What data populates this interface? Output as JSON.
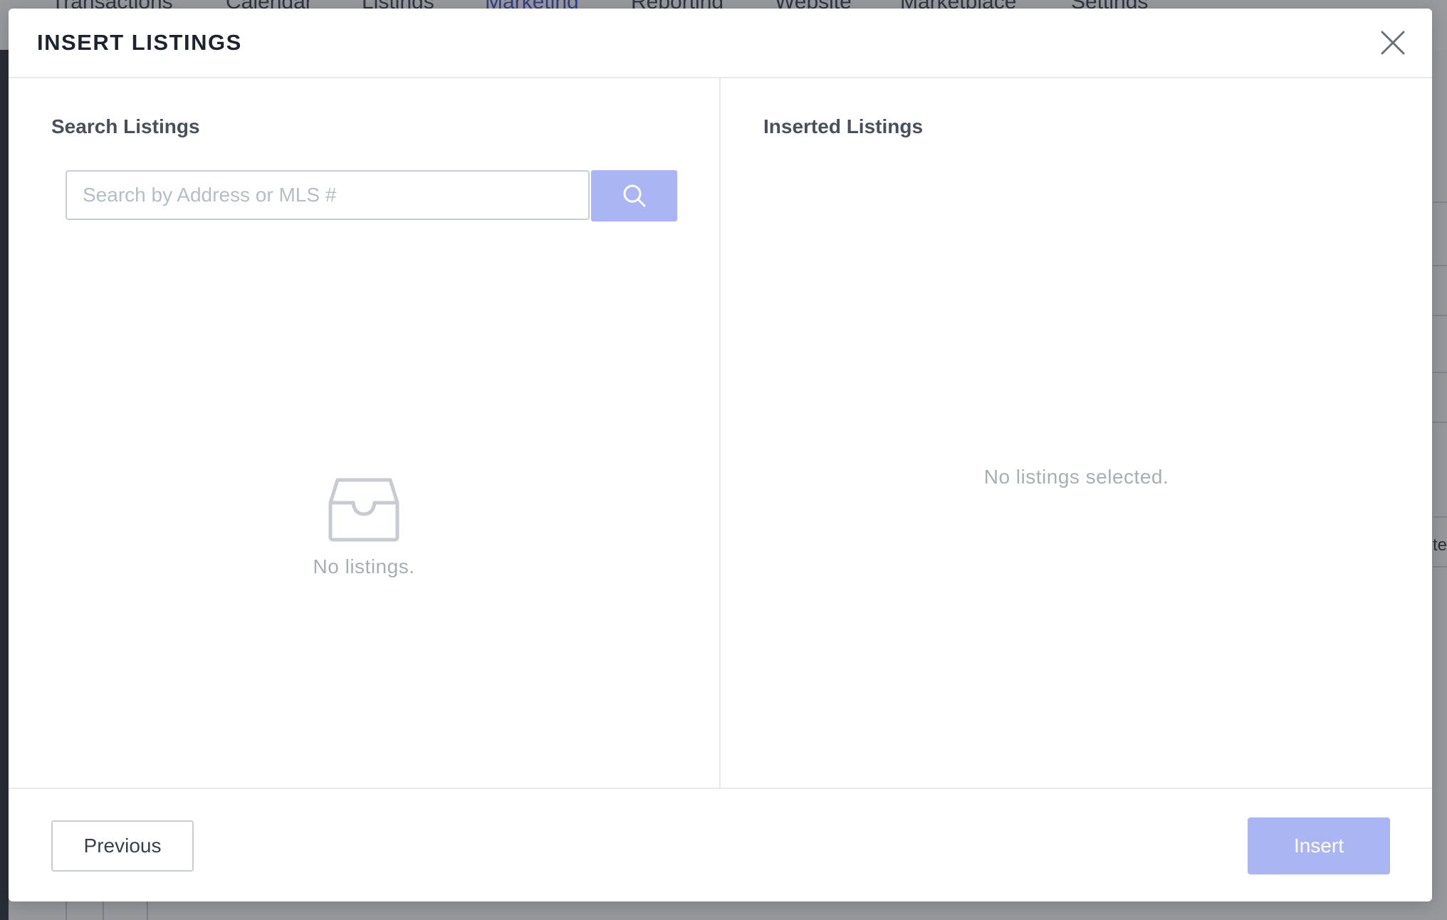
{
  "background": {
    "nav_items": [
      {
        "label": "Transactions",
        "active": false
      },
      {
        "label": "Calendar",
        "active": false
      },
      {
        "label": "Listings",
        "active": false
      },
      {
        "label": "Marketing",
        "active": true
      },
      {
        "label": "Reporting",
        "active": false
      },
      {
        "label": "Website",
        "active": false
      },
      {
        "label": "Marketplace",
        "active": false
      },
      {
        "label": "Settings",
        "active": false
      }
    ],
    "edge_text": "te"
  },
  "modal": {
    "title": "INSERT LISTINGS",
    "close_icon": "close-icon",
    "search_section": {
      "title": "Search Listings",
      "input_value": "",
      "input_placeholder": "Search by Address or MLS #",
      "search_icon": "search-icon",
      "empty_icon": "inbox-icon",
      "empty_text": "No listings."
    },
    "inserted_section": {
      "title": "Inserted Listings",
      "empty_text": "No listings selected."
    },
    "footer": {
      "previous_label": "Previous",
      "insert_label": "Insert"
    }
  },
  "colors": {
    "accent_disabled": "#aab6f3",
    "active_nav": "#3d4fd6",
    "muted_text": "#a9adb5",
    "title_text": "#1e2330"
  }
}
